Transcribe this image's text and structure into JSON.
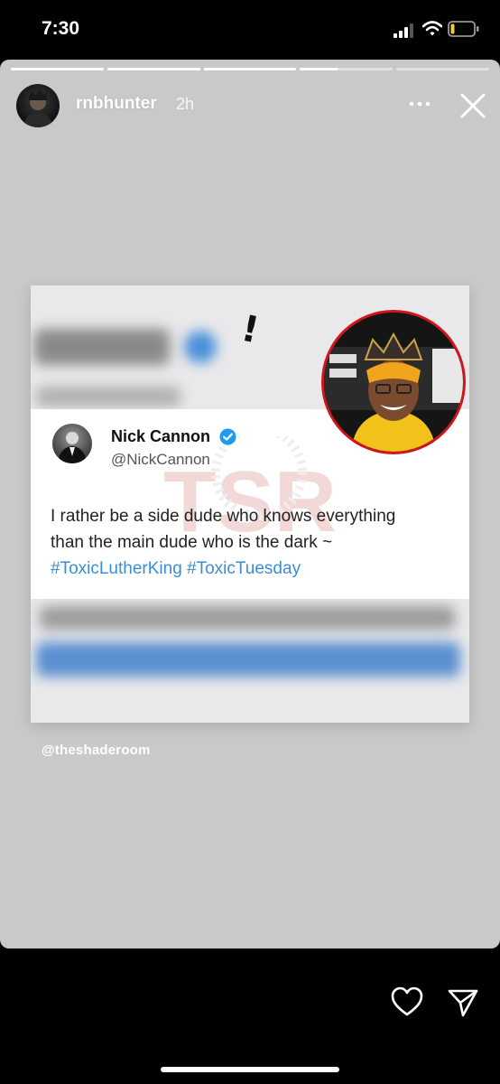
{
  "status_bar": {
    "time": "7:30"
  },
  "story": {
    "username": "rnbhunter",
    "time_ago": "2h",
    "progress": [
      1,
      1,
      1,
      0.4,
      0
    ],
    "mention_sticker": "@theshaderoom"
  },
  "post": {
    "tweet": {
      "name": "Nick Cannon",
      "handle": "@NickCannon",
      "text_line1": "I rather be a side dude who knows everything",
      "text_line2": "than the main dude who is the dark ~",
      "hashtag1": "#ToxicLutherKing",
      "hashtag2": "#ToxicTuesday"
    },
    "watermark": "TSR",
    "inset_accent": "#d0161c"
  },
  "colors": {
    "story_background": "#c9c9c9",
    "hashtag": "#3a8ed3",
    "verified": "#1d9bf0"
  },
  "icons": {
    "more": "ellipsis-icon",
    "close": "close-icon",
    "like": "heart-icon",
    "share": "paper-plane-icon"
  }
}
